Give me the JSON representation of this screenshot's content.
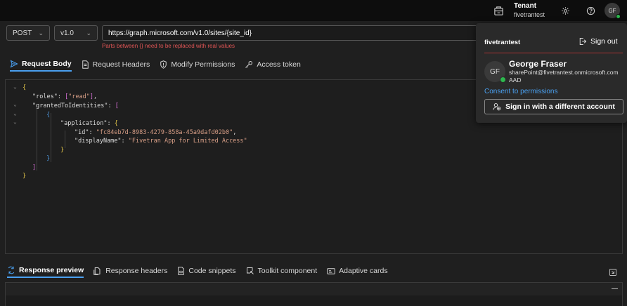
{
  "topbar": {
    "tenant_label": "Tenant",
    "tenant_name": "fivetrantest",
    "avatar_initials": "GF"
  },
  "request": {
    "method": "POST",
    "version": "v1.0",
    "url": "https://graph.microsoft.com/v1.0/sites/{site_id}",
    "warning": "Parts between {} need to be replaced with real values"
  },
  "request_tabs": [
    {
      "label": "Request Body",
      "icon": "send-icon"
    },
    {
      "label": "Request Headers",
      "icon": "document-icon"
    },
    {
      "label": "Modify Permissions",
      "icon": "shield-icon"
    },
    {
      "label": "Access token",
      "icon": "key-icon"
    }
  ],
  "body": {
    "roles_key": "\"roles\"",
    "roles_val": "\"read\"",
    "granted_key": "\"grantedToIdentities\"",
    "application_key": "\"application\"",
    "id_key": "\"id\"",
    "id_val": "\"fc84eb7d-8983-4279-858a-45a9dafd02b0\"",
    "display_key": "\"displayName\"",
    "display_val": "\"Fivetran App for Limited Access\""
  },
  "response_tabs": [
    {
      "label": "Response preview",
      "icon": "preview-icon"
    },
    {
      "label": "Response headers",
      "icon": "headers-icon"
    },
    {
      "label": "Code snippets",
      "icon": "snippet-icon"
    },
    {
      "label": "Toolkit component",
      "icon": "toolkit-icon"
    },
    {
      "label": "Adaptive cards",
      "icon": "card-icon"
    }
  ],
  "account_panel": {
    "tenant": "fivetrantest",
    "sign_out": "Sign out",
    "initials": "GF",
    "name": "George Fraser",
    "email": "sharePoint@fivetrantest.onmicrosoft.com",
    "type": "AAD",
    "consent_link": "Consent to permissions",
    "alt_account_button": "Sign in with a different account"
  },
  "colors": {
    "accent": "#4aa0f0",
    "warning": "#e05555",
    "presence": "#2db84d",
    "string": "#d69d85"
  }
}
